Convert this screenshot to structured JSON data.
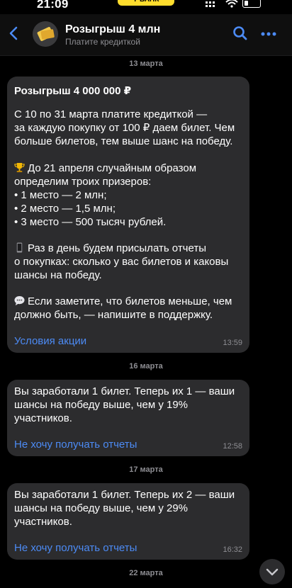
{
  "status_bar": {
    "time": "21:09",
    "carrier": "Т-БАНК"
  },
  "header": {
    "title": "Розыгрыш 4 млн",
    "subtitle": "Платите кредиткой"
  },
  "messages": [
    {
      "date": "13 марта",
      "heading": "Розыгрыш 4 000 000 ₽",
      "lines": [
        "С 10 по 31 марта платите кредиткой —",
        "за каждую покупку от 100 ₽ даем билет. Чем",
        "больше билетов, тем выше шанс на победу.",
        "",
        "До 21 апреля случайным образом",
        "определим троих призеров:",
        " • 1 место — 2 млн;",
        " • 2 место — 1,5 млн;",
        " • 3 место — 500 тысяч рублей.",
        "",
        "Раз в день будем присылать отчеты",
        "о покупках: сколько у вас билетов и каковы",
        "шансы на победу.",
        "",
        "Если заметите, что билетов меньше, чем",
        "должно быть, — напишите в поддержку."
      ],
      "link": "Условия акции",
      "time": "13:59"
    },
    {
      "date": "16 марта",
      "lines": [
        "Вы заработали 1 билет. Теперь их 1 — ваши",
        "шансы на победу выше, чем у 19%",
        "участников."
      ],
      "link": "Не хочу получать отчеты",
      "time": "12:58"
    },
    {
      "date": "17 марта",
      "lines": [
        "Вы заработали 1 билет. Теперь их 2 — ваши",
        "шансы на победу выше, чем у 29%",
        "участников."
      ],
      "link": "Не хочу получать отчеты",
      "time": "16:32"
    }
  ],
  "next_date": "22 марта",
  "colors": {
    "background": "#000000",
    "bubble": "#2c2c2e",
    "link": "#4c8bf5",
    "accent": "#ffdd2d"
  }
}
